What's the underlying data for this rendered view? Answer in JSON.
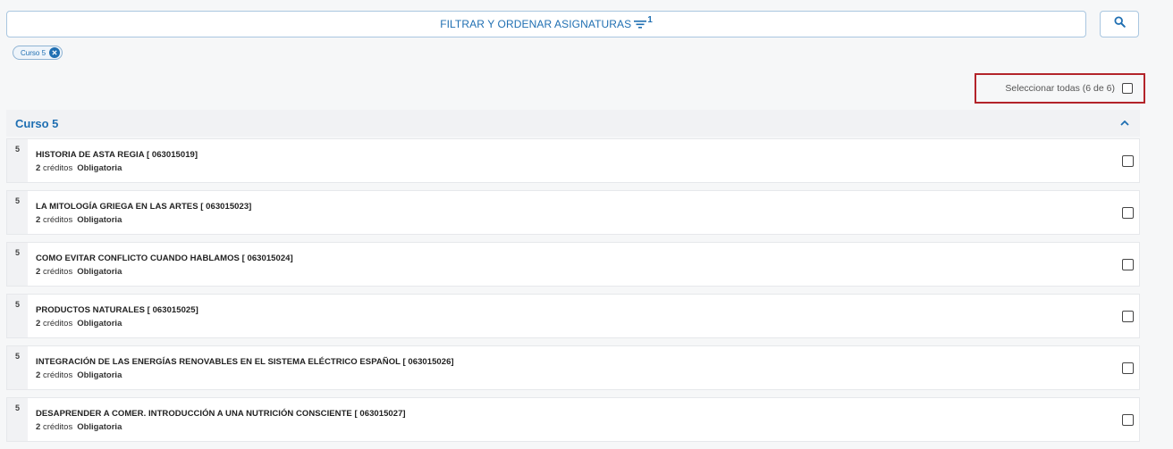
{
  "filter": {
    "label": "FILTRAR Y ORDENAR ASIGNATURAS",
    "count": "1",
    "icon": "filter-icon"
  },
  "search": {
    "icon": "search-icon"
  },
  "chip": {
    "label": "Curso 5",
    "icon": "close-circle-icon"
  },
  "select_all": {
    "label": "Seleccionar todas (6 de 6)",
    "checked": false
  },
  "group": {
    "title": "Curso 5",
    "icon": "chevron-up-icon"
  },
  "courses": [
    {
      "level": "5",
      "title": "HISTORIA DE ASTA REGIA [ 063015019]",
      "credits": "2",
      "credits_label": "créditos",
      "type": "Obligatoria"
    },
    {
      "level": "5",
      "title": "LA MITOLOGÍA GRIEGA EN LAS ARTES [ 063015023]",
      "credits": "2",
      "credits_label": "créditos",
      "type": "Obligatoria"
    },
    {
      "level": "5",
      "title": "COMO EVITAR CONFLICTO CUANDO HABLAMOS [ 063015024]",
      "credits": "2",
      "credits_label": "créditos",
      "type": "Obligatoria"
    },
    {
      "level": "5",
      "title": "PRODUCTOS NATURALES [ 063015025]",
      "credits": "2",
      "credits_label": "créditos",
      "type": "Obligatoria"
    },
    {
      "level": "5",
      "title": "INTEGRACIÓN DE LAS ENERGÍAS RENOVABLES EN EL SISTEMA ELÉCTRICO ESPAÑOL [ 063015026]",
      "credits": "2",
      "credits_label": "créditos",
      "type": "Obligatoria"
    },
    {
      "level": "5",
      "title": "DESAPRENDER A COMER. INTRODUCCIÓN A UNA NUTRICIÓN CONSCIENTE [ 063015027]",
      "credits": "2",
      "credits_label": "créditos",
      "type": "Obligatoria"
    }
  ],
  "colors": {
    "accent": "#1f6fb2",
    "highlight": "#b3242a"
  }
}
